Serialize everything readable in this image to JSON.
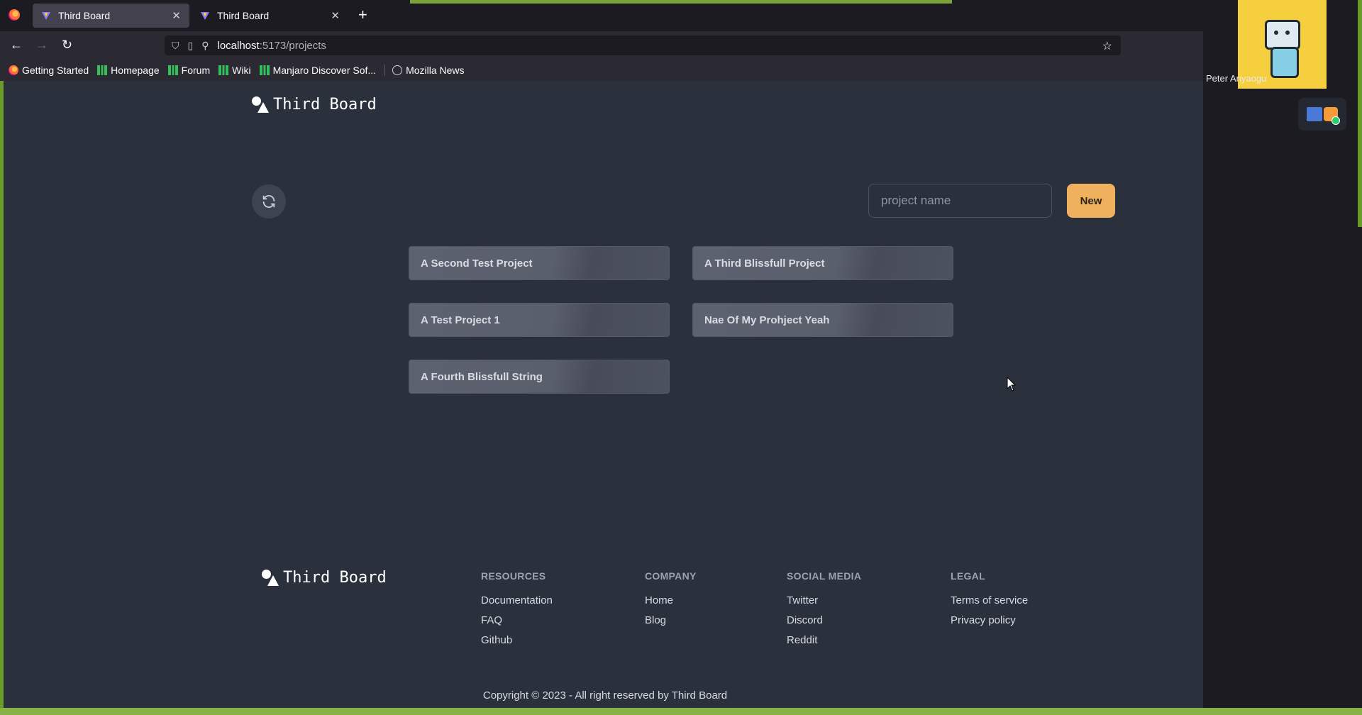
{
  "browser": {
    "tabs": [
      {
        "title": "Third Board",
        "active": true
      },
      {
        "title": "Third Board",
        "active": false
      }
    ],
    "new_tab_label": "+",
    "url_host": "localhost",
    "url_path": ":5173/projects",
    "bookmarks": [
      {
        "label": "Getting Started",
        "icon": "firefox-icon"
      },
      {
        "label": "Homepage",
        "icon": "manjaro-icon"
      },
      {
        "label": "Forum",
        "icon": "manjaro-icon"
      },
      {
        "label": "Wiki",
        "icon": "manjaro-icon"
      },
      {
        "label": "Manjaro Discover Sof...",
        "icon": "manjaro-icon"
      },
      {
        "label": "Mozilla News",
        "icon": "globe-icon"
      }
    ]
  },
  "header": {
    "brand": "Third Board"
  },
  "toolbar": {
    "project_name_placeholder": "project name",
    "new_label": "New"
  },
  "projects": [
    "A Second Test Project",
    "A Third Blissfull Project",
    "A Test Project 1",
    "Nae Of My Prohject Yeah",
    "A Fourth Blissfull String"
  ],
  "footer": {
    "brand": "Third Board",
    "columns": [
      {
        "heading": "RESOURCES",
        "links": [
          "Documentation",
          "FAQ",
          "Github"
        ]
      },
      {
        "heading": "COMPANY",
        "links": [
          "Home",
          "Blog"
        ]
      },
      {
        "heading": "SOCIAL MEDIA",
        "links": [
          "Twitter",
          "Discord",
          "Reddit"
        ]
      },
      {
        "heading": "LEGAL",
        "links": [
          "Terms of service",
          "Privacy policy"
        ]
      }
    ],
    "copyright": "Copyright © 2023 - All right reserved by Third Board"
  },
  "overlay": {
    "camera_name": "Peter Anyaogu"
  },
  "colors": {
    "accent": "#f0b15f",
    "page_bg": "#2a303c",
    "card_bg": "#5d6270"
  }
}
